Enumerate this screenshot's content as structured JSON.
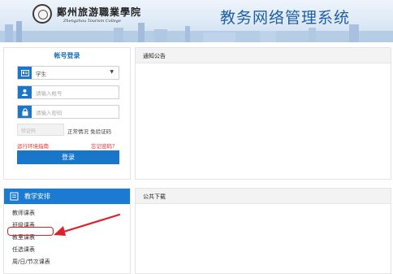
{
  "header": {
    "school_name_cn": "鄭州旅游職業學院",
    "school_name_en": "Zhengzhou Tourism College",
    "system_title": "教务网络管理系统"
  },
  "login": {
    "title": "帐号登录",
    "role_select": {
      "value": "学生"
    },
    "account_placeholder": "请输入帐号",
    "password_placeholder": "请输入密码",
    "captcha_placeholder": "验证码",
    "captcha_note": "正常情况  免验证码",
    "env_guide_link": "运行环境指南",
    "forgot_link": "忘记密码？",
    "login_button": "登录"
  },
  "schedule": {
    "title": "教学安排",
    "items": [
      "教师课表",
      "班级课表",
      "教室课表",
      "任选课表",
      "周/日/节次课表"
    ]
  },
  "notice": {
    "title": "通知公告"
  },
  "downloads": {
    "title": "公共下载"
  },
  "colors": {
    "accent": "#1976c9",
    "annotation": "#e0202a",
    "title": "#1f5fa8"
  },
  "icons": [
    "id-card-icon",
    "user-icon",
    "lock-icon",
    "book-icon",
    "annotation-arrow"
  ]
}
